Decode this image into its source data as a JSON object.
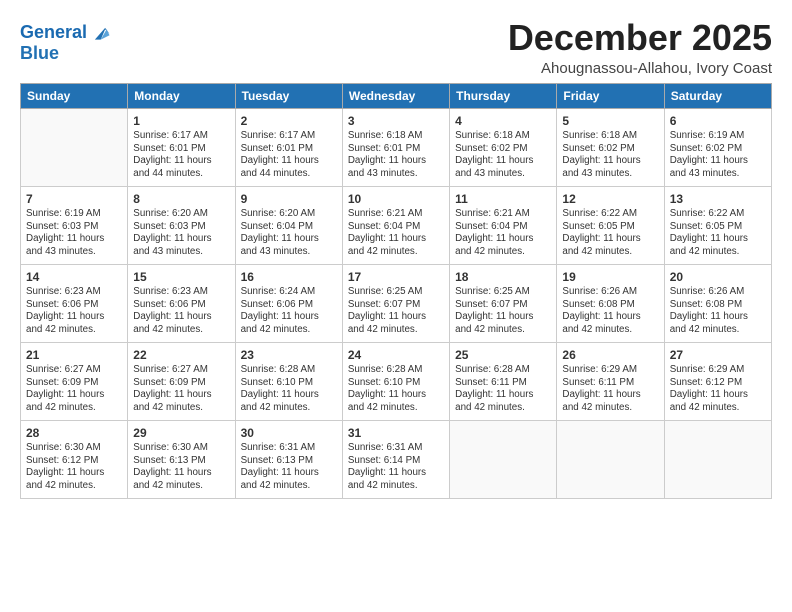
{
  "logo": {
    "line1": "General",
    "line2": "Blue"
  },
  "header": {
    "month": "December 2025",
    "location": "Ahougnassou-Allahou, Ivory Coast"
  },
  "weekdays": [
    "Sunday",
    "Monday",
    "Tuesday",
    "Wednesday",
    "Thursday",
    "Friday",
    "Saturday"
  ],
  "weeks": [
    [
      {
        "day": "",
        "info": ""
      },
      {
        "day": "1",
        "info": "Sunrise: 6:17 AM\nSunset: 6:01 PM\nDaylight: 11 hours\nand 44 minutes."
      },
      {
        "day": "2",
        "info": "Sunrise: 6:17 AM\nSunset: 6:01 PM\nDaylight: 11 hours\nand 44 minutes."
      },
      {
        "day": "3",
        "info": "Sunrise: 6:18 AM\nSunset: 6:01 PM\nDaylight: 11 hours\nand 43 minutes."
      },
      {
        "day": "4",
        "info": "Sunrise: 6:18 AM\nSunset: 6:02 PM\nDaylight: 11 hours\nand 43 minutes."
      },
      {
        "day": "5",
        "info": "Sunrise: 6:18 AM\nSunset: 6:02 PM\nDaylight: 11 hours\nand 43 minutes."
      },
      {
        "day": "6",
        "info": "Sunrise: 6:19 AM\nSunset: 6:02 PM\nDaylight: 11 hours\nand 43 minutes."
      }
    ],
    [
      {
        "day": "7",
        "info": "Sunrise: 6:19 AM\nSunset: 6:03 PM\nDaylight: 11 hours\nand 43 minutes."
      },
      {
        "day": "8",
        "info": "Sunrise: 6:20 AM\nSunset: 6:03 PM\nDaylight: 11 hours\nand 43 minutes."
      },
      {
        "day": "9",
        "info": "Sunrise: 6:20 AM\nSunset: 6:04 PM\nDaylight: 11 hours\nand 43 minutes."
      },
      {
        "day": "10",
        "info": "Sunrise: 6:21 AM\nSunset: 6:04 PM\nDaylight: 11 hours\nand 42 minutes."
      },
      {
        "day": "11",
        "info": "Sunrise: 6:21 AM\nSunset: 6:04 PM\nDaylight: 11 hours\nand 42 minutes."
      },
      {
        "day": "12",
        "info": "Sunrise: 6:22 AM\nSunset: 6:05 PM\nDaylight: 11 hours\nand 42 minutes."
      },
      {
        "day": "13",
        "info": "Sunrise: 6:22 AM\nSunset: 6:05 PM\nDaylight: 11 hours\nand 42 minutes."
      }
    ],
    [
      {
        "day": "14",
        "info": "Sunrise: 6:23 AM\nSunset: 6:06 PM\nDaylight: 11 hours\nand 42 minutes."
      },
      {
        "day": "15",
        "info": "Sunrise: 6:23 AM\nSunset: 6:06 PM\nDaylight: 11 hours\nand 42 minutes."
      },
      {
        "day": "16",
        "info": "Sunrise: 6:24 AM\nSunset: 6:06 PM\nDaylight: 11 hours\nand 42 minutes."
      },
      {
        "day": "17",
        "info": "Sunrise: 6:25 AM\nSunset: 6:07 PM\nDaylight: 11 hours\nand 42 minutes."
      },
      {
        "day": "18",
        "info": "Sunrise: 6:25 AM\nSunset: 6:07 PM\nDaylight: 11 hours\nand 42 minutes."
      },
      {
        "day": "19",
        "info": "Sunrise: 6:26 AM\nSunset: 6:08 PM\nDaylight: 11 hours\nand 42 minutes."
      },
      {
        "day": "20",
        "info": "Sunrise: 6:26 AM\nSunset: 6:08 PM\nDaylight: 11 hours\nand 42 minutes."
      }
    ],
    [
      {
        "day": "21",
        "info": "Sunrise: 6:27 AM\nSunset: 6:09 PM\nDaylight: 11 hours\nand 42 minutes."
      },
      {
        "day": "22",
        "info": "Sunrise: 6:27 AM\nSunset: 6:09 PM\nDaylight: 11 hours\nand 42 minutes."
      },
      {
        "day": "23",
        "info": "Sunrise: 6:28 AM\nSunset: 6:10 PM\nDaylight: 11 hours\nand 42 minutes."
      },
      {
        "day": "24",
        "info": "Sunrise: 6:28 AM\nSunset: 6:10 PM\nDaylight: 11 hours\nand 42 minutes."
      },
      {
        "day": "25",
        "info": "Sunrise: 6:28 AM\nSunset: 6:11 PM\nDaylight: 11 hours\nand 42 minutes."
      },
      {
        "day": "26",
        "info": "Sunrise: 6:29 AM\nSunset: 6:11 PM\nDaylight: 11 hours\nand 42 minutes."
      },
      {
        "day": "27",
        "info": "Sunrise: 6:29 AM\nSunset: 6:12 PM\nDaylight: 11 hours\nand 42 minutes."
      }
    ],
    [
      {
        "day": "28",
        "info": "Sunrise: 6:30 AM\nSunset: 6:12 PM\nDaylight: 11 hours\nand 42 minutes."
      },
      {
        "day": "29",
        "info": "Sunrise: 6:30 AM\nSunset: 6:13 PM\nDaylight: 11 hours\nand 42 minutes."
      },
      {
        "day": "30",
        "info": "Sunrise: 6:31 AM\nSunset: 6:13 PM\nDaylight: 11 hours\nand 42 minutes."
      },
      {
        "day": "31",
        "info": "Sunrise: 6:31 AM\nSunset: 6:14 PM\nDaylight: 11 hours\nand 42 minutes."
      },
      {
        "day": "",
        "info": ""
      },
      {
        "day": "",
        "info": ""
      },
      {
        "day": "",
        "info": ""
      }
    ]
  ]
}
